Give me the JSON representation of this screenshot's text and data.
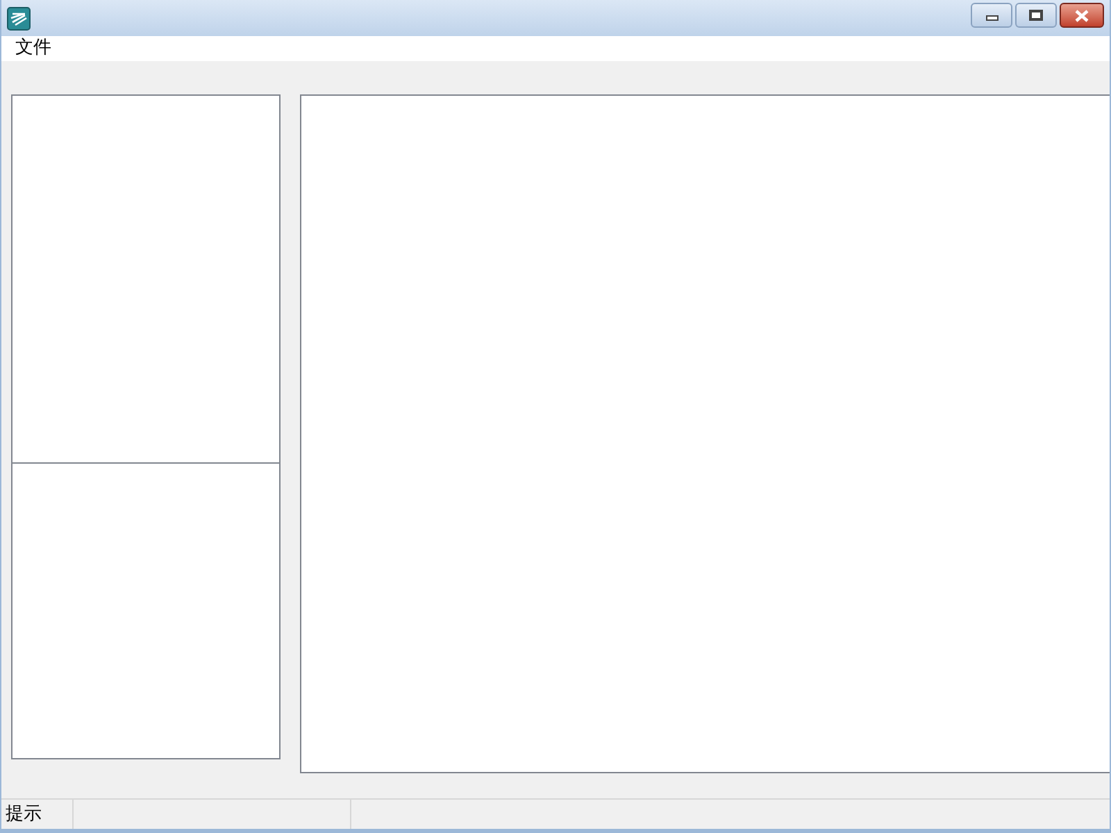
{
  "menu": [
    {
      "label": "文件"
    }
  ],
  "status_bar": {
    "panes": [
      "提示"
    ]
  }
}
